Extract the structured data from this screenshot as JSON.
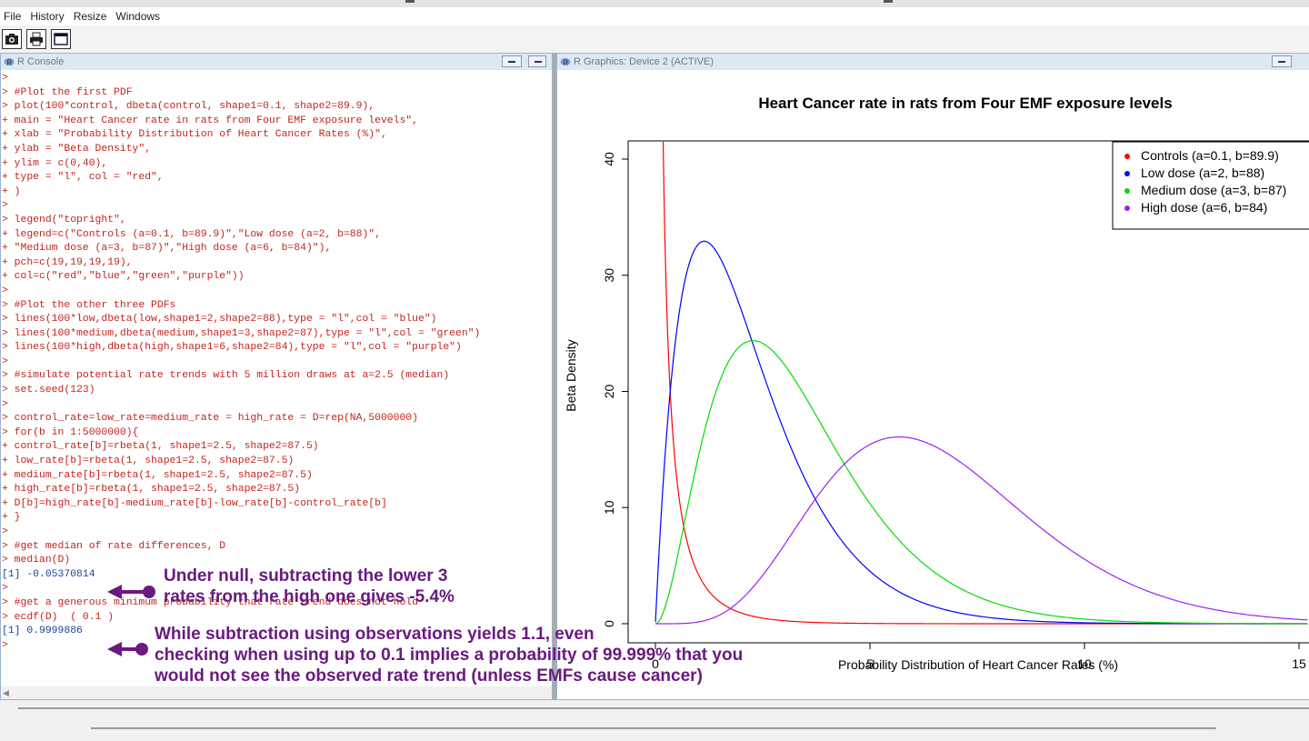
{
  "menu": [
    "File",
    "History",
    "Resize",
    "Windows"
  ],
  "toolbar_icons": [
    "camera-icon",
    "printer-icon",
    "window-icon"
  ],
  "console": {
    "title": "R Console",
    "lines": [
      {
        "t": ">",
        "c": "red"
      },
      {
        "t": "> #Plot the first PDF",
        "c": "red"
      },
      {
        "t": "> plot(100*control, dbeta(control, shape1=0.1, shape2=89.9),",
        "c": "red"
      },
      {
        "t": "+ main = \"Heart Cancer rate in rats from Four EMF exposure levels\",",
        "c": "red"
      },
      {
        "t": "+ xlab = \"Probability Distribution of Heart Cancer Rates (%)\",",
        "c": "red"
      },
      {
        "t": "+ ylab = \"Beta Density\",",
        "c": "red"
      },
      {
        "t": "+ ylim = c(0,40),",
        "c": "red"
      },
      {
        "t": "+ type = \"l\", col = \"red\",",
        "c": "red"
      },
      {
        "t": "+ )",
        "c": "red"
      },
      {
        "t": ">",
        "c": "red"
      },
      {
        "t": "> legend(\"topright\",",
        "c": "red"
      },
      {
        "t": "+ legend=c(\"Controls (a=0.1, b=89.9)\",\"Low dose (a=2, b=88)\",",
        "c": "red"
      },
      {
        "t": "+ \"Medium dose (a=3, b=87)\",\"High dose (a=6, b=84)\"),",
        "c": "red"
      },
      {
        "t": "+ pch=c(19,19,19,19),",
        "c": "red"
      },
      {
        "t": "+ col=c(\"red\",\"blue\",\"green\",\"purple\"))",
        "c": "red"
      },
      {
        "t": ">",
        "c": "red"
      },
      {
        "t": "> #Plot the other three PDFs",
        "c": "red"
      },
      {
        "t": "> lines(100*low,dbeta(low,shape1=2,shape2=88),type = \"l\",col = \"blue\")",
        "c": "red"
      },
      {
        "t": "> lines(100*medium,dbeta(medium,shape1=3,shape2=87),type = \"l\",col = \"green\")",
        "c": "red"
      },
      {
        "t": "> lines(100*high,dbeta(high,shape1=6,shape2=84),type = \"l\",col = \"purple\")",
        "c": "red"
      },
      {
        "t": ">",
        "c": "red"
      },
      {
        "t": "> #simulate potential rate trends with 5 million draws at a=2.5 (median)",
        "c": "red"
      },
      {
        "t": "> set.seed(123)",
        "c": "red"
      },
      {
        "t": ">",
        "c": "red"
      },
      {
        "t": "> control_rate=low_rate=medium_rate = high_rate = D=rep(NA,5000000)",
        "c": "red"
      },
      {
        "t": "> for(b in 1:5000000){",
        "c": "red"
      },
      {
        "t": "+ control_rate[b]=rbeta(1, shape1=2.5, shape2=87.5)",
        "c": "red"
      },
      {
        "t": "+ low_rate[b]=rbeta(1, shape1=2.5, shape2=87.5)",
        "c": "red"
      },
      {
        "t": "+ medium_rate[b]=rbeta(1, shape1=2.5, shape2=87.5)",
        "c": "red"
      },
      {
        "t": "+ high_rate[b]=rbeta(1, shape1=2.5, shape2=87.5)",
        "c": "red"
      },
      {
        "t": "+ D[b]=high_rate[b]-medium_rate[b]-low_rate[b]-control_rate[b]",
        "c": "red"
      },
      {
        "t": "+ }",
        "c": "red"
      },
      {
        "t": ">",
        "c": "red"
      },
      {
        "t": "> #get median of rate differences, D",
        "c": "red"
      },
      {
        "t": "> median(D)",
        "c": "red"
      },
      {
        "t": "[1] -0.05370814",
        "c": "blue"
      },
      {
        "t": ">",
        "c": "red"
      },
      {
        "t": "> #get a generous minimum probability that rate trend does not hold",
        "c": "red"
      },
      {
        "t": "> ecdf(D)  ( 0.1 )",
        "c": "red"
      },
      {
        "t": "[1] 0.9999886",
        "c": "blue"
      },
      {
        "t": ">",
        "c": "red"
      }
    ]
  },
  "annotations": {
    "median": "Under null, subtracting the lower 3\nrates from the high one gives -5.4%",
    "ecdf": "While subtraction using observations yields 1.1, even\nchecking when using up to 0.1 implies a probability of 99.999% that you\nwould not see the observed rate trend (unless EMFs cause cancer)"
  },
  "annotation_color": "#6a1a80",
  "graphics": {
    "title": "R Graphics: Device 2 (ACTIVE)"
  },
  "chart_data": {
    "type": "line",
    "title": "Heart Cancer rate in rats from Four EMF exposure levels",
    "xlabel": "Probability Distribution of Heart Cancer Rates (%)",
    "ylabel": "Beta Density",
    "xlim": [
      0,
      15
    ],
    "ylim": [
      0,
      40
    ],
    "xticks": [
      "0",
      "5",
      "10",
      "15"
    ],
    "yticks": [
      "0",
      "10",
      "20",
      "30",
      "40"
    ],
    "legend_position": "top-right",
    "series": [
      {
        "name": "Controls (a=0.1, b=89.9)",
        "color": "#ff0000",
        "a": 0.1,
        "b": 89.9
      },
      {
        "name": "Low dose (a=2, b=88)",
        "color": "#0000ff",
        "a": 2,
        "b": 88
      },
      {
        "name": "Medium dose (a=3, b=87)",
        "color": "#00dd00",
        "a": 3,
        "b": 87
      },
      {
        "name": "High dose (a=6, b=84)",
        "color": "#a020f0",
        "a": 6,
        "b": 84
      }
    ]
  }
}
